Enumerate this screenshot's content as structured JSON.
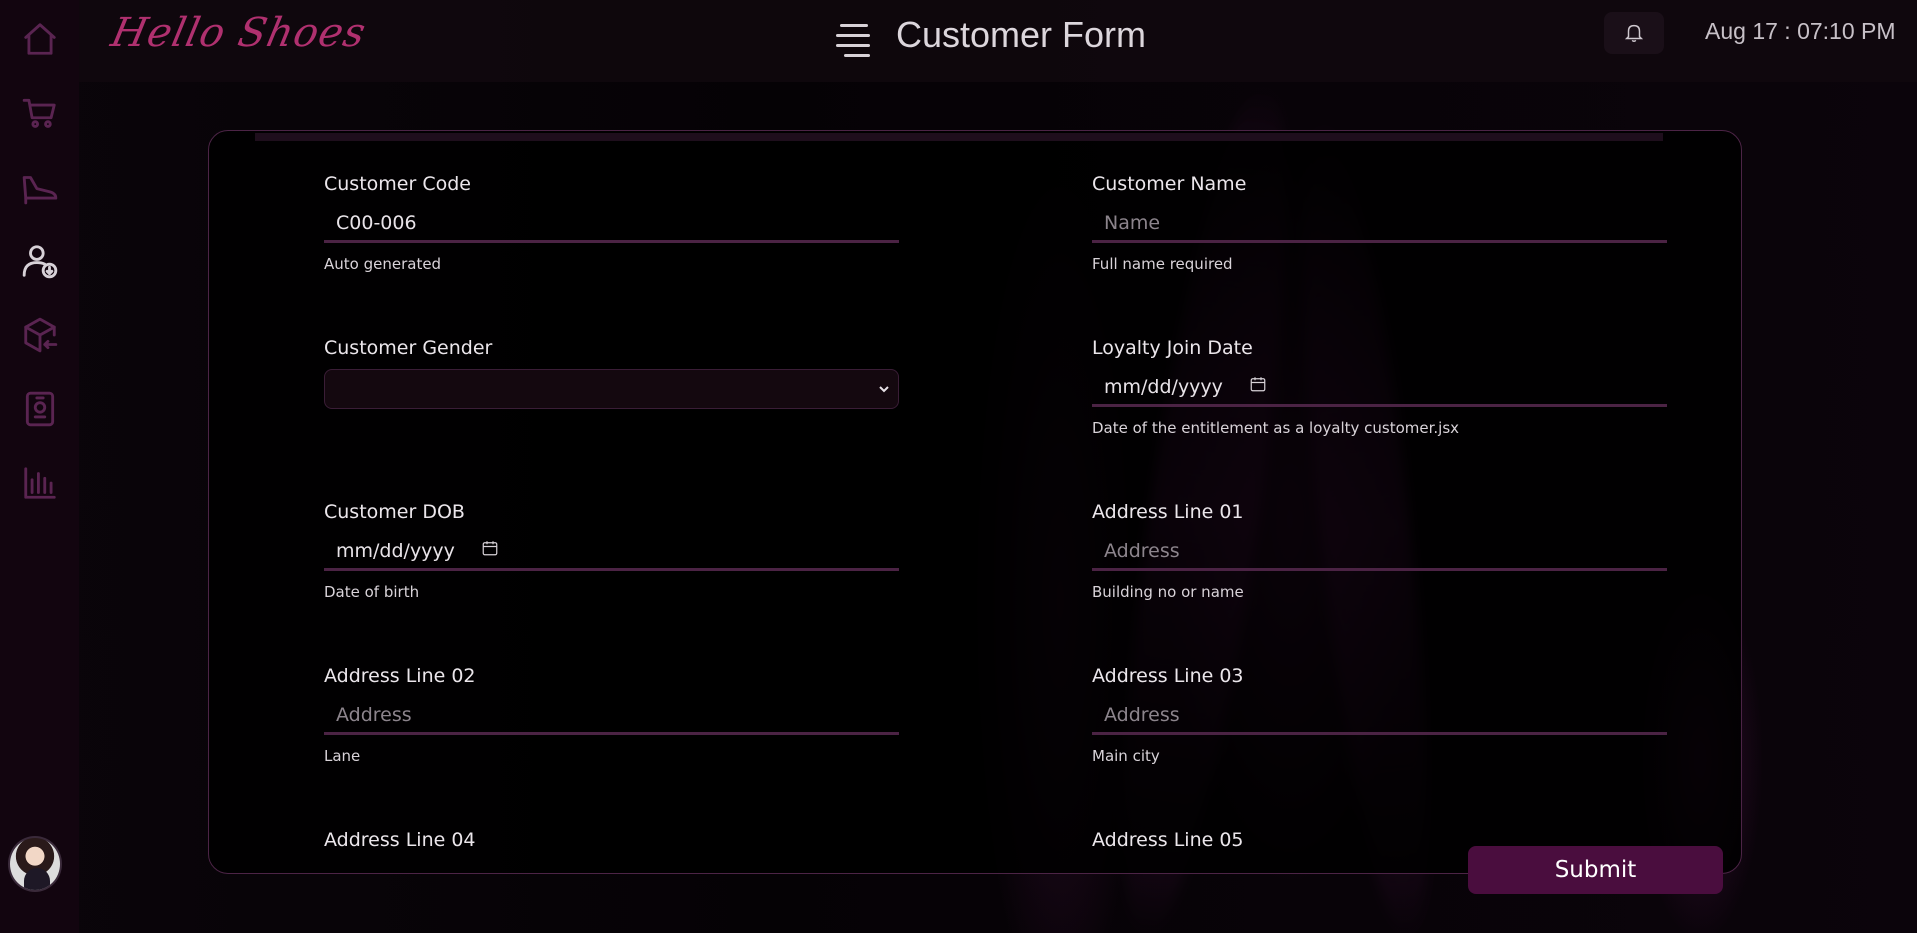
{
  "brand": {
    "logo_text": "Hello Shoes"
  },
  "header": {
    "title": "Customer Form",
    "datetime": "Aug 17 : 07:10 PM"
  },
  "sidebar": {
    "items": [
      {
        "icon": "home-icon"
      },
      {
        "icon": "cart-icon"
      },
      {
        "icon": "shoe-icon"
      },
      {
        "icon": "user-add-icon",
        "active": true
      },
      {
        "icon": "box-return-icon"
      },
      {
        "icon": "employee-badge-icon"
      },
      {
        "icon": "bar-chart-icon"
      }
    ]
  },
  "form": {
    "customer_code": {
      "label": "Customer Code",
      "value": "C00-006",
      "helper": "Auto generated"
    },
    "customer_name": {
      "label": "Customer Name",
      "placeholder": "Name",
      "helper": "Full name required"
    },
    "customer_gender": {
      "label": "Customer Gender",
      "value": ""
    },
    "loyalty_join_date": {
      "label": "Loyalty Join Date",
      "value": "mm/dd/yyyy",
      "helper": "Date of the entitlement as a loyalty customer.jsx"
    },
    "customer_dob": {
      "label": "Customer DOB",
      "value": "mm/dd/yyyy",
      "helper": "Date of birth"
    },
    "address_line_01": {
      "label": "Address Line 01",
      "placeholder": "Address",
      "helper": "Building no or name"
    },
    "address_line_02": {
      "label": "Address Line 02",
      "placeholder": "Address",
      "helper": "Lane"
    },
    "address_line_03": {
      "label": "Address Line 03",
      "placeholder": "Address",
      "helper": "Main city"
    },
    "address_line_04": {
      "label": "Address Line 04"
    },
    "address_line_05": {
      "label": "Address Line 05"
    },
    "submit_label": "Submit"
  },
  "colors": {
    "accent": "#4a0d3e",
    "logo": "#b0306f",
    "underline": "#4b2344"
  }
}
